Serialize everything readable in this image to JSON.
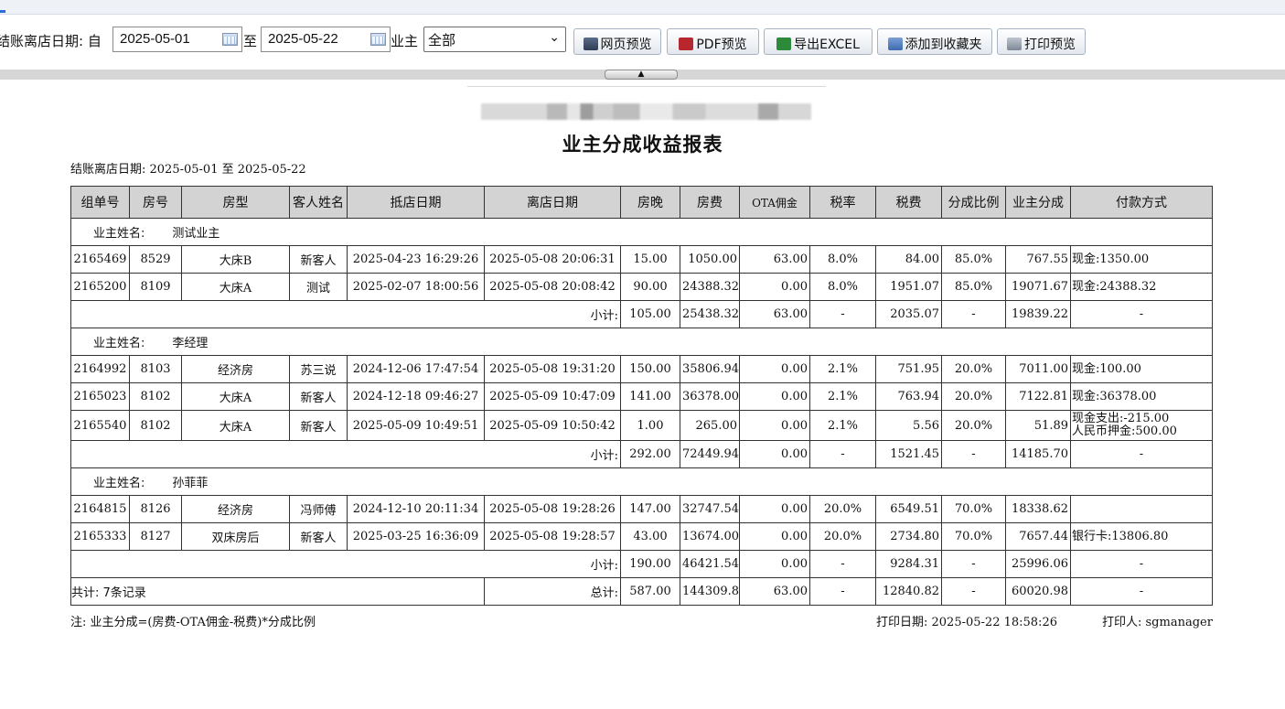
{
  "toolbar": {
    "checkout_date_label": "结账离店日期: 自",
    "date_from": "2025-05-01",
    "to_label": "至",
    "date_to": "2025-05-22",
    "owner_label": "业主",
    "owner_select": "全部",
    "buttons": {
      "web_preview": "网页预览",
      "pdf_preview": "PDF预览",
      "export_excel": "导出EXCEL",
      "add_favorite": "添加到收藏夹",
      "print_preview": "打印预览"
    }
  },
  "report": {
    "title": "业主分成收益报表",
    "date_range": "结账离店日期: 2025-05-01 至 2025-05-22",
    "columns": [
      "组单号",
      "房号",
      "房型",
      "客人姓名",
      "抵店日期",
      "离店日期",
      "房晚",
      "房费",
      "OTA佣金",
      "税率",
      "税费",
      "分成比例",
      "业主分成",
      "付款方式"
    ],
    "owner_label": "业主姓名:",
    "subtotal_label": "小计:",
    "groups": [
      {
        "owner": "测试业主",
        "rows": [
          {
            "id": "2165469",
            "room": "8529",
            "type": "大床B",
            "guest": "新客人",
            "arrive": "2025-04-23 16:29:26",
            "depart": "2025-05-08 20:06:31",
            "nights": "15.00",
            "fee": "1050.00",
            "ota": "63.00",
            "taxrate": "8.0%",
            "tax": "84.00",
            "ratio": "85.0%",
            "share": "767.55",
            "pay1": "现金:1350.00",
            "pay2": ""
          },
          {
            "id": "2165200",
            "room": "8109",
            "type": "大床A",
            "guest": "测试",
            "arrive": "2025-02-07 18:00:56",
            "depart": "2025-05-08 20:08:42",
            "nights": "90.00",
            "fee": "24388.32",
            "ota": "0.00",
            "taxrate": "8.0%",
            "tax": "1951.07",
            "ratio": "85.0%",
            "share": "19071.67",
            "pay1": "现金:24388.32",
            "pay2": ""
          }
        ],
        "subtotal": {
          "nights": "105.00",
          "fee": "25438.32",
          "ota": "63.00",
          "taxrate": "-",
          "tax": "2035.07",
          "ratio": "-",
          "share": "19839.22",
          "pay": "-"
        }
      },
      {
        "owner": "李经理",
        "rows": [
          {
            "id": "2164992",
            "room": "8103",
            "type": "经济房",
            "guest": "苏三说",
            "arrive": "2024-12-06 17:47:54",
            "depart": "2025-05-08 19:31:20",
            "nights": "150.00",
            "fee": "35806.94",
            "ota": "0.00",
            "taxrate": "2.1%",
            "tax": "751.95",
            "ratio": "20.0%",
            "share": "7011.00",
            "pay1": "现金:100.00",
            "pay2": ""
          },
          {
            "id": "2165023",
            "room": "8102",
            "type": "大床A",
            "guest": "新客人",
            "arrive": "2024-12-18 09:46:27",
            "depart": "2025-05-09 10:47:09",
            "nights": "141.00",
            "fee": "36378.00",
            "ota": "0.00",
            "taxrate": "2.1%",
            "tax": "763.94",
            "ratio": "20.0%",
            "share": "7122.81",
            "pay1": "现金:36378.00",
            "pay2": ""
          },
          {
            "id": "2165540",
            "room": "8102",
            "type": "大床A",
            "guest": "新客人",
            "arrive": "2025-05-09 10:49:51",
            "depart": "2025-05-09 10:50:42",
            "nights": "1.00",
            "fee": "265.00",
            "ota": "0.00",
            "taxrate": "2.1%",
            "tax": "5.56",
            "ratio": "20.0%",
            "share": "51.89",
            "pay1": "现金支出:-215.00",
            "pay2": "人民币押金:500.00"
          }
        ],
        "subtotal": {
          "nights": "292.00",
          "fee": "72449.94",
          "ota": "0.00",
          "taxrate": "-",
          "tax": "1521.45",
          "ratio": "-",
          "share": "14185.70",
          "pay": "-"
        }
      },
      {
        "owner": "孙菲菲",
        "rows": [
          {
            "id": "2164815",
            "room": "8126",
            "type": "经济房",
            "guest": "冯师傅",
            "arrive": "2024-12-10 20:11:34",
            "depart": "2025-05-08 19:28:26",
            "nights": "147.00",
            "fee": "32747.54",
            "ota": "0.00",
            "taxrate": "20.0%",
            "tax": "6549.51",
            "ratio": "70.0%",
            "share": "18338.62",
            "pay1": "",
            "pay2": ""
          },
          {
            "id": "2165333",
            "room": "8127",
            "type": "双床房后",
            "guest": "新客人",
            "arrive": "2025-03-25 16:36:09",
            "depart": "2025-05-08 19:28:57",
            "nights": "43.00",
            "fee": "13674.00",
            "ota": "0.00",
            "taxrate": "20.0%",
            "tax": "2734.80",
            "ratio": "70.0%",
            "share": "7657.44",
            "pay1": "银行卡:13806.80",
            "pay2": ""
          }
        ],
        "subtotal": {
          "nights": "190.00",
          "fee": "46421.54",
          "ota": "0.00",
          "taxrate": "-",
          "tax": "9284.31",
          "ratio": "-",
          "share": "25996.06",
          "pay": "-"
        }
      }
    ],
    "total": {
      "count_label": "共计: 7条记录",
      "label": "总计:",
      "nights": "587.00",
      "fee": "144309.80",
      "ota": "63.00",
      "taxrate": "-",
      "tax": "12840.82",
      "ratio": "-",
      "share": "60020.98",
      "pay": "-"
    },
    "footnote": "注: 业主分成=(房费-OTA佣金-税费)*分成比例",
    "print_date": "打印日期: 2025-05-22 18:58:26",
    "printer": "打印人: sgmanager"
  }
}
